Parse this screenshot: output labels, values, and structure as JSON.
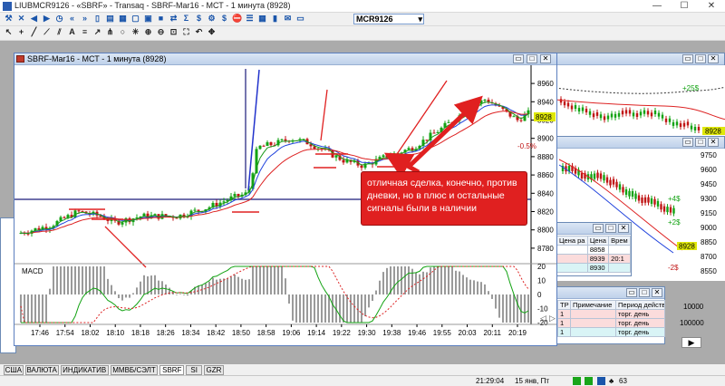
{
  "app": {
    "title": "LIUBMCR9126 - «SBRF» - Transaq - SBRF-Mar16 - МСТ - 1 минута (8928)",
    "minimize": "—",
    "maximize": "☐",
    "close": "✕"
  },
  "toolbar1": {
    "icons": [
      "tools-icon",
      "close-icon",
      "back-icon",
      "forward-icon",
      "clock-icon",
      "nav-left-icon",
      "nav-right-icon",
      "blank-doc-icon",
      "chart-icon",
      "calculator-icon",
      "window-icon",
      "order-icon",
      "stop-icon",
      "transfer-icon",
      "sigma-icon",
      "dollar-icon",
      "gear-icon",
      "dollar2-icon",
      "stop-order-icon",
      "list-icon",
      "grid-icon",
      "bar-icon",
      "message-icon",
      "folder-icon"
    ],
    "symbol": "MCR9126"
  },
  "toolbar2": {
    "icons": [
      "cursor-icon",
      "crosshair-icon",
      "line-icon",
      "trend-icon",
      "channel-icon",
      "text-icon",
      "fib-icon",
      "arrow-icon",
      "pitchfork-icon",
      "cycle-icon",
      "gann-icon",
      "zoom-in-icon",
      "zoom-out-icon",
      "fit-icon",
      "zoom-all-icon",
      "undo-icon",
      "pan-icon"
    ]
  },
  "main_window": {
    "title": "SBRF-Mar16 - МСТ - 1 минута (8928)",
    "minimize": "▭",
    "maximize": "□",
    "close": "✕",
    "price_ticks": [
      "8960",
      "8940",
      "8920",
      "8900",
      "8880",
      "8860",
      "8840",
      "8820",
      "8800",
      "8780"
    ],
    "last_price": "8928",
    "pct_label": "-0.5%",
    "time_ticks": [
      "17:46",
      "17:54",
      "18:02",
      "18:10",
      "18:18",
      "18:26",
      "18:34",
      "18:42",
      "18:50",
      "18:58",
      "19:06",
      "19:14",
      "19:22",
      "19:30",
      "19:38",
      "19:46",
      "19:55",
      "20:03",
      "20:11",
      "20:19"
    ],
    "macd_label": "MACD",
    "macd_ticks": [
      "20",
      "10",
      "0",
      "-10",
      "-20"
    ]
  },
  "annotation": {
    "text": "отличная сделка, конечно, против дневки, но в плюс и остальные сигналы были в наличии"
  },
  "right_window1": {
    "title": "",
    "last_price": "8928",
    "pct1": "+25$",
    "pct2": "+4$",
    "pct3": "+2$",
    "pct4": "-2$",
    "price_ticks": [
      "9750",
      "9600",
      "9450",
      "9300",
      "9150",
      "9000",
      "8850",
      "8700",
      "8550"
    ],
    "volume_ticks": [
      "10000",
      "100000"
    ],
    "tick_9900": "9900"
  },
  "right_window2": {
    "title": ""
  },
  "quote_window": {
    "headers": [
      "Цена",
      "Врем"
    ],
    "left_label": "Цена ра",
    "rows": [
      [
        "8858",
        ""
      ],
      [
        "8939",
        "20:1"
      ],
      [
        "8930",
        ""
      ]
    ]
  },
  "trades_window": {
    "headers": [
      "TP",
      "Примечание",
      "Период действ"
    ],
    "rows": [
      [
        "1",
        "",
        "торг. день"
      ],
      [
        "1",
        "",
        "торг. день"
      ],
      [
        "1",
        "",
        "торг. день"
      ]
    ]
  },
  "tabs": [
    "США",
    "ВАЛЮТА",
    "ИНДИКАТИВ",
    "ММВБ/СЭЛТ",
    "SBRF",
    "SI",
    "GZR"
  ],
  "active_tab": "SBRF",
  "status": {
    "clock": "21:29:04",
    "date": "15 янв, Пт",
    "conn": "63"
  },
  "colors": {
    "accent": "#e02020",
    "candle_up": "#13a313",
    "candle_down": "#c01515",
    "ema_fast": "#2244dd",
    "ema_slow": "#dd2222",
    "level_line": "#1a1a7a"
  }
}
